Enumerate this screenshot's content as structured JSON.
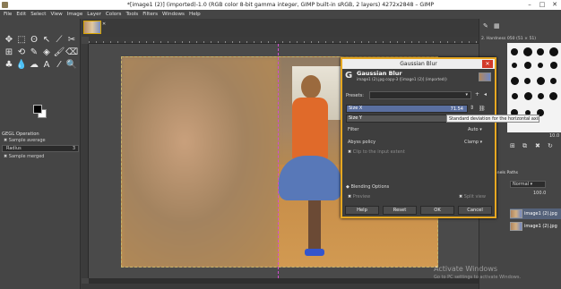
{
  "window": {
    "title": "*[image1 (2)] (imported)-1.0 (RGB color 8-bit gamma integer, GIMP built-in sRGB, 2 layers) 4272x2848 – GIMP",
    "minimize": "–",
    "maximize": "□",
    "close": "✕"
  },
  "menu": [
    "File",
    "Edit",
    "Select",
    "View",
    "Image",
    "Layer",
    "Colors",
    "Tools",
    "Filters",
    "Windows",
    "Help"
  ],
  "toolbox": {
    "tools": [
      "✥",
      "⬚",
      "ʘ",
      "↖",
      "⟋",
      "✂",
      "⊞",
      "⟲",
      "✎",
      "◈",
      "🖌",
      "⌫",
      "♣",
      "💧",
      "☁",
      "A",
      "⁄",
      "🔍"
    ],
    "options_title": "GEGL Operation",
    "sample_average": "Sample average",
    "radius_label": "Radius",
    "radius_value": "3",
    "sample_merged": "Sample merged"
  },
  "dock": {
    "brush_name": "2. Hardness 050 (51 × 51)",
    "spacing": "10.0",
    "layers_tabs": "Channels  Paths",
    "mode": "Normal",
    "opacity": "100.0",
    "layers": [
      {
        "name": "image1 (2).jpg"
      },
      {
        "name": "image1 (2).jpg"
      }
    ]
  },
  "dialog": {
    "title": "Gaussian Blur",
    "close": "✕",
    "heading": "Gaussian Blur",
    "subtitle": "image1 (2).jpg copy-3 ([image1 (2)] (imported))",
    "presets_label": "Presets:",
    "size_x_label": "Size X",
    "size_x_value": "71.54",
    "size_y_label": "Size Y",
    "tooltip": "Standard deviation for the horizontal axis",
    "filter_label": "Filter",
    "filter_value": "Auto",
    "abyss_label": "Abyss policy",
    "abyss_value": "Clamp",
    "clip_label": "Clip to the input extent",
    "blending_label": "Blending Options",
    "preview_label": "Preview",
    "split_label": "Split view",
    "buttons": {
      "help": "Help",
      "reset": "Reset",
      "ok": "OK",
      "cancel": "Cancel"
    }
  },
  "watermark": {
    "line1": "Activate Windows",
    "line2": "Go to PC settings to activate Windows."
  }
}
